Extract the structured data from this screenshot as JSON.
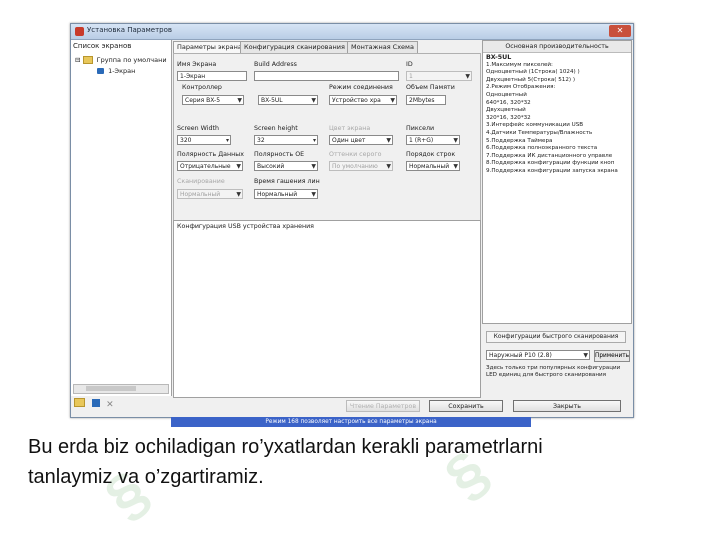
{
  "window": {
    "title": "Установка Параметров",
    "close_glyph": "✕"
  },
  "left_panel": {
    "title": "Список экранов",
    "tree": [
      {
        "label": "Группа по умолчани",
        "expander": "⊟"
      },
      {
        "label": "1-Экран"
      }
    ]
  },
  "tabs": [
    "Параметры экрана",
    "Конфигурация сканирования",
    "Монтажная Схема"
  ],
  "form": {
    "screen_name": {
      "label": "Имя Экрана",
      "value": "1-Экран"
    },
    "build_address": {
      "label": "Build Address",
      "value": ""
    },
    "id": {
      "label": "ID",
      "value": "1"
    },
    "controller": {
      "label": "Контроллер",
      "series": "Серия BX-5",
      "model": "BX-5UL"
    },
    "connection_mode": {
      "label": "Режим соединения",
      "value": "Устройство хра"
    },
    "memory": {
      "label": "Объем Памяти",
      "value": "2Mbytes"
    },
    "screen_width": {
      "label": "Screen Width",
      "value": "320"
    },
    "screen_height": {
      "label": "Screen height",
      "value": "32"
    },
    "color_type": {
      "label": "Цвет экрана",
      "value": "Один цвет"
    },
    "pixels": {
      "label": "Пиксели",
      "value": "1 (R+G)"
    },
    "data_polarity": {
      "label": "Полярность Данных",
      "value": "Отрицательные"
    },
    "oe_polarity": {
      "label": "Полярность OE",
      "value": "Высокий"
    },
    "gray_scale": {
      "label": "Оттенки серого",
      "value": "По умолчанию"
    },
    "row_order": {
      "label": "Порядок строк",
      "value": "Нормальный"
    },
    "disabled_extra": {
      "label": "Сканирование",
      "value": "Нормальный"
    },
    "dim_time": {
      "label": "Время гашения лин",
      "value": "Нормальный"
    }
  },
  "usb_config_title": "Конфигурация USB устройства хранения",
  "info_panel": {
    "title": "Основная производительность",
    "model": "BX-5UL",
    "lines": [
      "1.Максимум пикселей:",
      "Одноцветный  (1Строка( 1024) )",
      "Двухцветный 5(Строка( 512) )",
      "2.Режим Отображения:",
      "Одноцветный",
      "   640*16, 320*32",
      "Двухцветный",
      "   320*16, 320*32",
      "3.Интерфейс коммуникации USB",
      "4.Датчики Температуры/Влажность",
      "5.Поддержка Таймера",
      "6.Поддержка полноэкранного текста",
      "7.Поддержка ИК дистанционного управле",
      "8.Поддержка конфигурации функции кноп",
      "9.Поддержка конфигурации запуска экрана"
    ]
  },
  "fast_scan": {
    "title": "Конфигурации быстрого сканирования",
    "selected": "Наружный P10 (2.8)",
    "button": "Применить",
    "note": "Здесь только три популярных конфигурации LED единиц для быстрого сканирования"
  },
  "buttons": {
    "read": "Чтение Параметров",
    "save": "Сохранить",
    "close": "Закрыть"
  },
  "status_bar": "Режим 168 позволяет настроить все параметры экрана",
  "caption": {
    "line1": "Bu erda biz ochiladigan ro’yxatlardan kerakli parametrlarni",
    "line2": "tanlaymiz va o’zgartiramiz."
  }
}
